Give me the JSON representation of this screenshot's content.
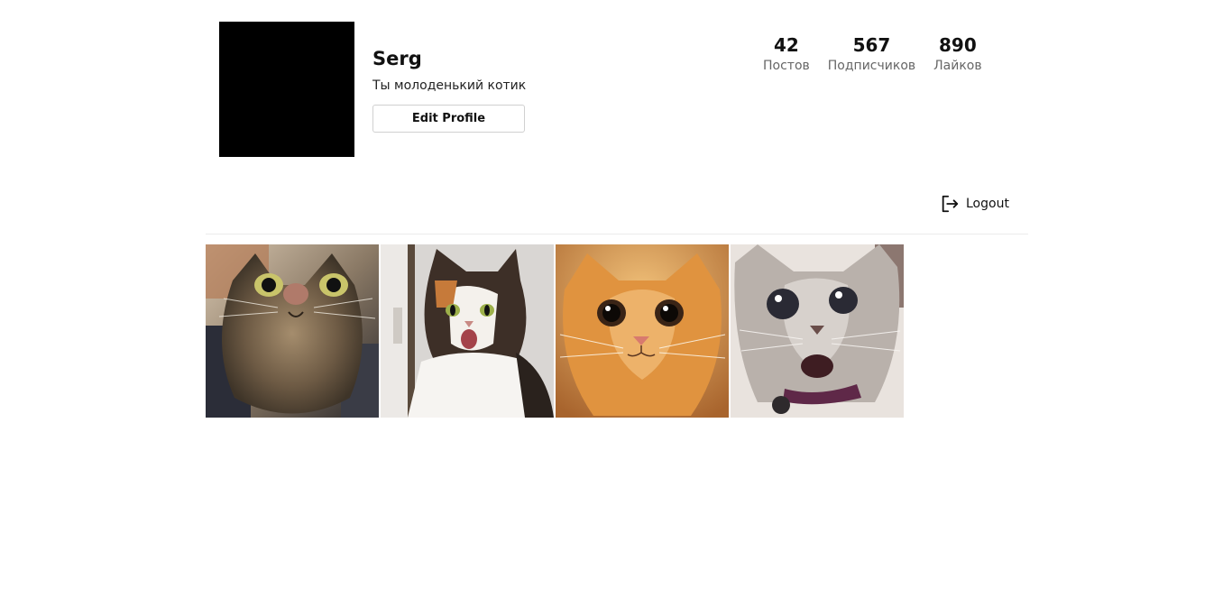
{
  "profile": {
    "username": "Serg",
    "bio": "Ты молоденький котик",
    "edit_label": "Edit Profile"
  },
  "stats": [
    {
      "value": "42",
      "label": "Постов"
    },
    {
      "value": "567",
      "label": "Подписчиков"
    },
    {
      "value": "890",
      "label": "Лайков"
    }
  ],
  "logout": {
    "label": "Logout",
    "icon": "logout-icon"
  },
  "posts": [
    {
      "icon": "tabby-cat-photo"
    },
    {
      "icon": "calico-cat-photo"
    },
    {
      "icon": "ginger-cat-photo"
    },
    {
      "icon": "grey-tabby-cat-photo"
    }
  ]
}
